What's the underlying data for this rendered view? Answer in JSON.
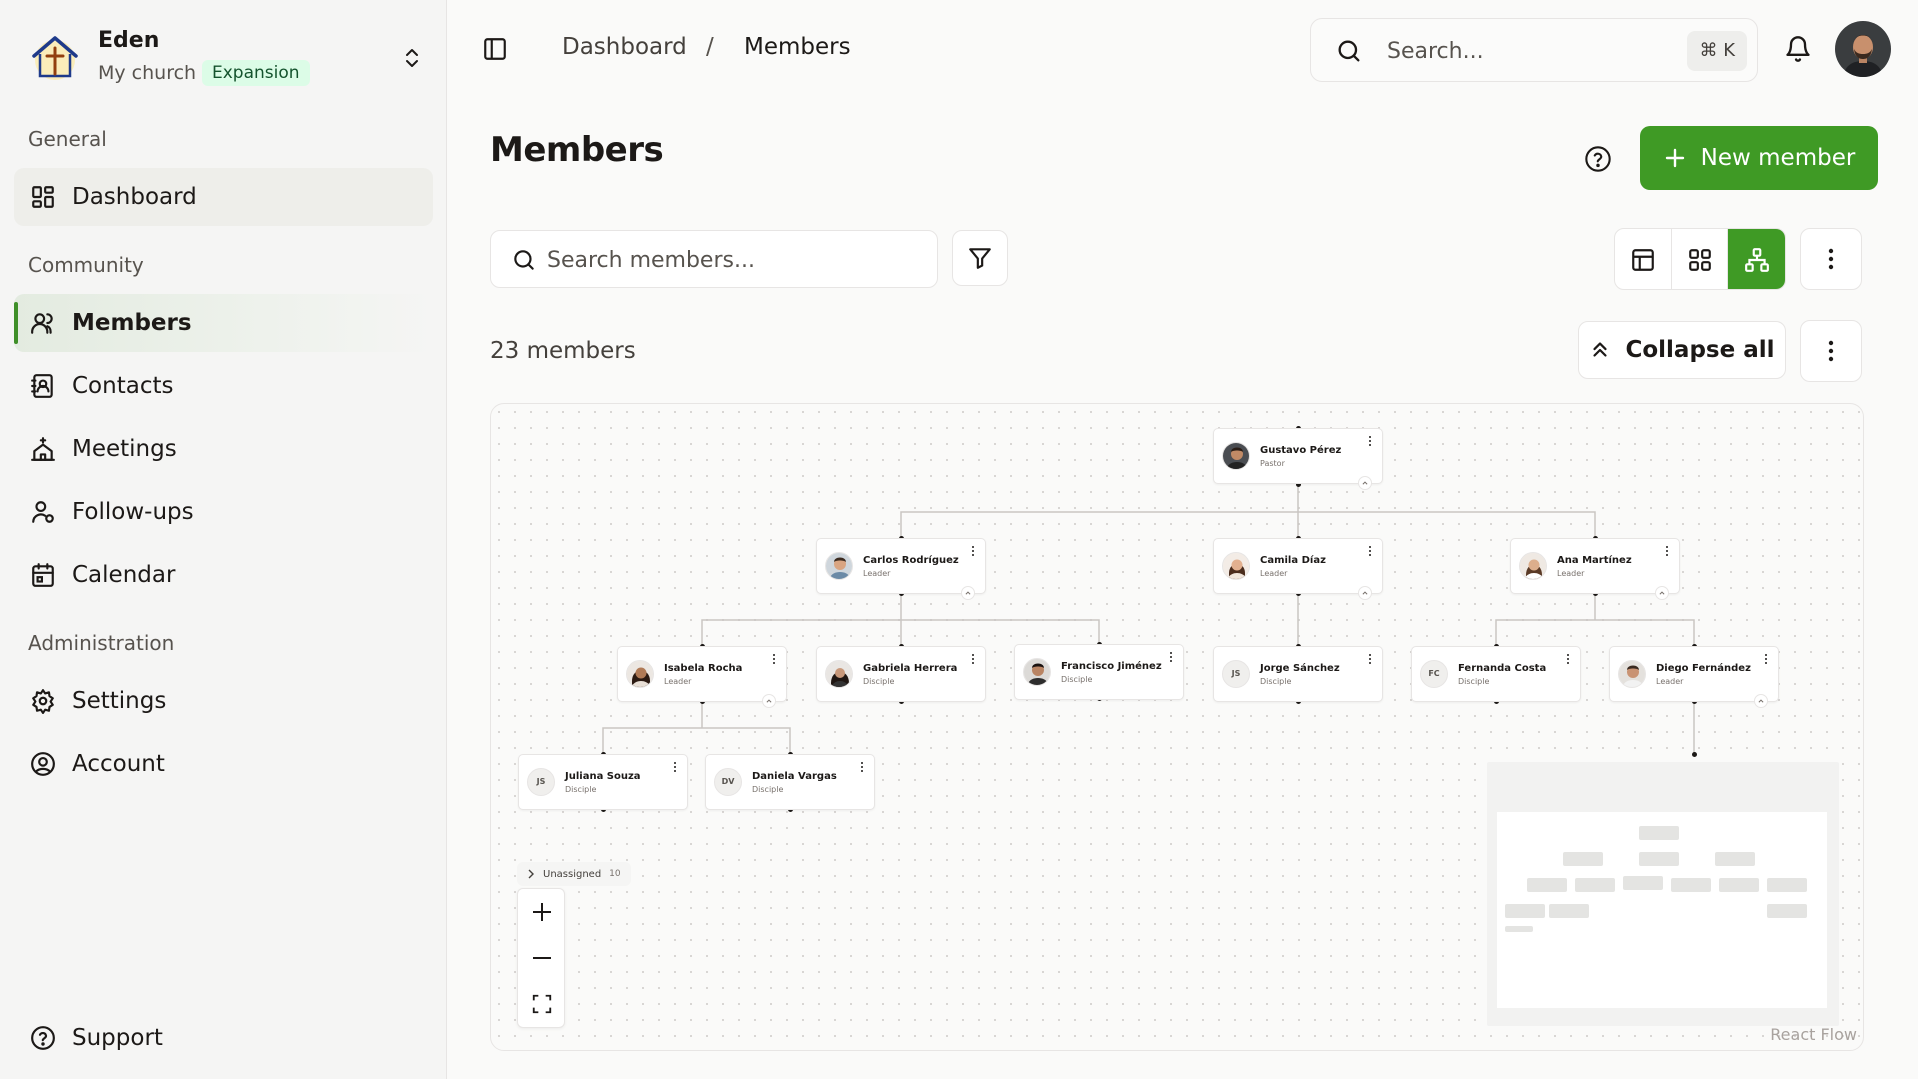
{
  "org": {
    "name": "Eden",
    "subtitle": "My church",
    "plan": "Expansion"
  },
  "sidebar": {
    "groups": {
      "general": "General",
      "community": "Community",
      "administration": "Administration"
    },
    "items": {
      "dashboard": "Dashboard",
      "members": "Members",
      "contacts": "Contacts",
      "meetings": "Meetings",
      "followups": "Follow-ups",
      "calendar": "Calendar",
      "settings": "Settings",
      "account": "Account",
      "support": "Support"
    },
    "active": "members"
  },
  "header": {
    "breadcrumb": [
      "Dashboard",
      "/",
      "Members"
    ],
    "search_placeholder": "Search...",
    "search_shortcut": "⌘ K"
  },
  "page": {
    "title": "Members",
    "new_member_label": "New member",
    "search_placeholder": "Search members...",
    "count_label": "23 members",
    "collapse_label": "Collapse all",
    "active_view": "tree"
  },
  "tree": {
    "nodes": {
      "gustavo": {
        "name": "Gustavo Pérez",
        "role": "Pastor",
        "initials": ""
      },
      "carlos": {
        "name": "Carlos Rodríguez",
        "role": "Leader",
        "initials": ""
      },
      "camila": {
        "name": "Camila Díaz",
        "role": "Leader",
        "initials": ""
      },
      "ana": {
        "name": "Ana Martínez",
        "role": "Leader",
        "initials": ""
      },
      "isabela": {
        "name": "Isabela Rocha",
        "role": "Leader",
        "initials": ""
      },
      "gabriela": {
        "name": "Gabriela Herrera",
        "role": "Disciple",
        "initials": ""
      },
      "francisco": {
        "name": "Francisco Jiménez",
        "role": "Disciple",
        "initials": ""
      },
      "jorge": {
        "name": "Jorge Sánchez",
        "role": "Disciple",
        "initials": "JS"
      },
      "fernanda": {
        "name": "Fernanda Costa",
        "role": "Disciple",
        "initials": "FC"
      },
      "diego": {
        "name": "Diego Fernández",
        "role": "Leader",
        "initials": ""
      },
      "juliana": {
        "name": "Juliana Souza",
        "role": "Disciple",
        "initials": "JS"
      },
      "daniela": {
        "name": "Daniela Vargas",
        "role": "Disciple",
        "initials": "DV"
      }
    },
    "unassigned": {
      "label": "Unassigned",
      "count": "10"
    },
    "attribution": "React Flow"
  },
  "colors": {
    "accent": "#3f9a25",
    "active_bar": "#3f8f28",
    "badge_bg": "#dcfce7"
  }
}
